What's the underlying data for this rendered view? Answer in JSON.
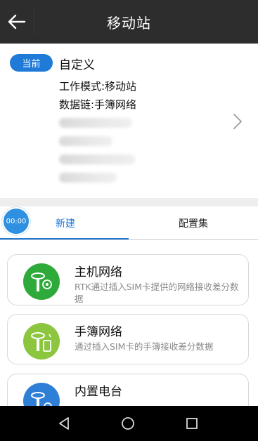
{
  "app_bar": {
    "title": "移动站",
    "back_icon": "back-arrow-icon"
  },
  "current": {
    "badge": "当前",
    "name": "自定义",
    "work_mode": "工作模式:移动站",
    "data_link": "数据链:手簿网络"
  },
  "timer": "00:00",
  "tabs": [
    {
      "label": "新建",
      "active": true
    },
    {
      "label": "配置集",
      "active": false
    }
  ],
  "options": [
    {
      "title": "主机网络",
      "desc": "RTK通过插入SIM卡提供的网络接收差分数据",
      "icon": "receiver-network-icon",
      "color": "#2eaa3a"
    },
    {
      "title": "手簿网络",
      "desc": "通过插入SIM卡的手簿接收差分数据",
      "icon": "receiver-handheld-icon",
      "color": "#8cc63f"
    },
    {
      "title": "内置电台",
      "desc": "",
      "icon": "receiver-radio-icon",
      "color": "#2f7fd6"
    }
  ],
  "colors": {
    "accent": "#1f7ad8",
    "app_bar": "#2d2d2d"
  },
  "nav": {
    "back": "nav-back-icon",
    "home": "nav-home-icon",
    "recents": "nav-recents-icon"
  }
}
